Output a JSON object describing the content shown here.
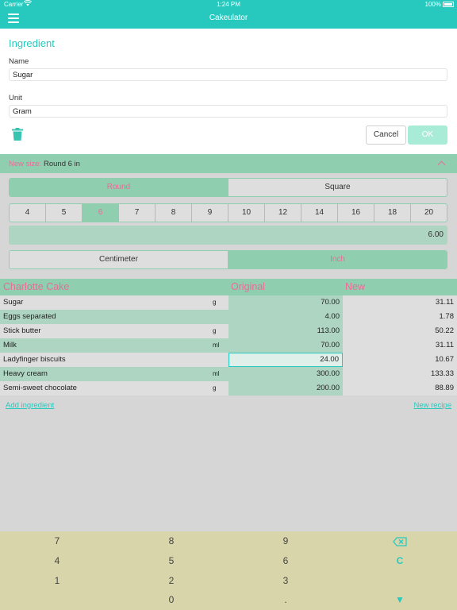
{
  "status_bar": {
    "carrier": "Carrier",
    "time": "1:24 PM",
    "battery": "100%"
  },
  "nav": {
    "title": "Cakeulator",
    "menu_icon": "hamburger-menu-icon"
  },
  "ingredient_form": {
    "heading": "Ingredient",
    "name_label": "Name",
    "name_value": "Sugar",
    "unit_label": "Unit",
    "unit_value": "Gram",
    "cancel_label": "Cancel",
    "ok_label": "OK",
    "delete_icon": "trash-icon"
  },
  "size_bar": {
    "label": "New size:",
    "value": "Round 6 in"
  },
  "shape_options": [
    "Round",
    "Square"
  ],
  "shape_selected": "Round",
  "sizes": [
    "4",
    "5",
    "6",
    "7",
    "8",
    "9",
    "10",
    "12",
    "14",
    "16",
    "18",
    "20"
  ],
  "size_selected": "6",
  "size_value": "6.00",
  "unit_options": [
    "Centimeter",
    "Inch"
  ],
  "unit_selected": "Inch",
  "recipe": {
    "name": "Charlotte Cake",
    "col_original": "Original",
    "col_new": "New",
    "rows": [
      {
        "name": "Sugar",
        "unit": "g",
        "original": "70.00",
        "new": "31.11"
      },
      {
        "name": "Eggs separated",
        "unit": "",
        "original": "4.00",
        "new": "1.78"
      },
      {
        "name": "Stick butter",
        "unit": "g",
        "original": "113.00",
        "new": "50.22"
      },
      {
        "name": "Milk",
        "unit": "ml",
        "original": "70.00",
        "new": "31.11"
      },
      {
        "name": "Ladyfinger biscuits",
        "unit": "",
        "original": "24.00",
        "new": "10.67"
      },
      {
        "name": "Heavy cream",
        "unit": "ml",
        "original": "300.00",
        "new": "133.33"
      },
      {
        "name": "Semi-sweet chocolate",
        "unit": "g",
        "original": "200.00",
        "new": "88.89"
      }
    ],
    "add_ingredient": "Add ingredient",
    "new_recipe": "New recipe"
  },
  "keypad": {
    "keys": [
      "7",
      "8",
      "9",
      "⌫",
      "4",
      "5",
      "6",
      "C",
      "1",
      "2",
      "3",
      "",
      "",
      "0",
      ".",
      "▼"
    ]
  },
  "colors": {
    "teal": "#27c9be",
    "green": "#8fcfb0",
    "pink": "#e86c97",
    "keypad": "#d9d5ab"
  }
}
